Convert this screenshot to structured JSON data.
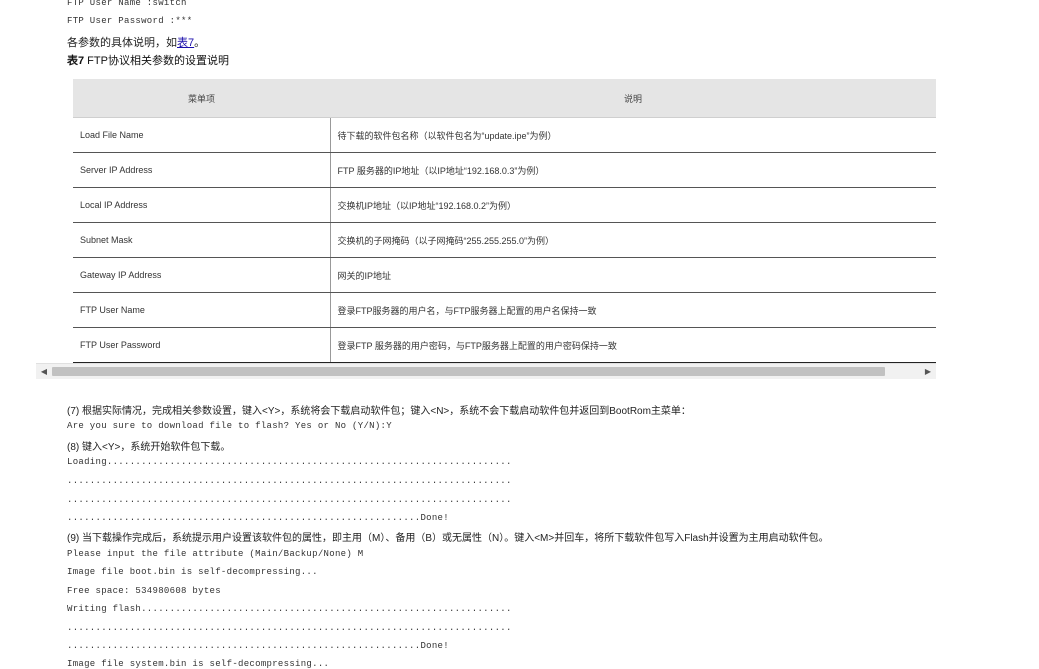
{
  "top_lines": {
    "user_name": "FTP User Name       :switch",
    "user_password": "FTP User Password   :***"
  },
  "intro": {
    "before_link": "各参数的具体说明，如",
    "link": "表7",
    "after_link": "。"
  },
  "caption": {
    "label": "表7",
    "text": " FTP协议相关参数的设置说明"
  },
  "table": {
    "headers": [
      "菜单项",
      "说明"
    ],
    "rows": [
      [
        "Load File Name",
        "待下载的软件包名称（以软件包名为“update.ipe”为例）"
      ],
      [
        "Server IP Address",
        "FTP 服务器的IP地址（以IP地址“192.168.0.3”为例）"
      ],
      [
        "Local IP Address",
        "交换机IP地址（以IP地址“192.168.0.2”为例）"
      ],
      [
        "Subnet Mask",
        "交换机的子网掩码（以子网掩码“255.255.255.0”为例）"
      ],
      [
        "Gateway IP Address",
        "网关的IP地址"
      ],
      [
        "FTP User Name",
        "登录FTP服务器的用户名，与FTP服务器上配置的用户名保持一致"
      ],
      [
        "FTP User Password",
        "登录FTP 服务器的用户密码，与FTP服务器上配置的用户密码保持一致"
      ]
    ]
  },
  "scrollbar": {
    "left_arrow": "◀",
    "right_arrow": "▶"
  },
  "steps": {
    "step7": "(7)   根据实际情况，完成相关参数设置，键入<Y>，系统将会下载启动软件包；键入<N>，系统不会下载启动软件包并返回到BootRom主菜单：",
    "confirm": "Are you sure to download file to flash? Yes or No (Y/N):Y",
    "step8": "(8)   键入<Y>，系统开始软件包下载。",
    "loading1": "Loading.......................................................................",
    "loading2": "..............................................................................",
    "loading3": "..............................................................................",
    "loading_done": "..............................................................Done!",
    "step9": "(9)   当下载操作完成后，系统提示用户设置该软件包的属性，即主用（M）、备用（B）或无属性（N）。键入<M>并回车，将所下载软件包写入Flash并设置为主用启动软件包。",
    "input_attr": "Please input the file attribute (Main/Backup/None) M",
    "self_decomp1": "Image file boot.bin is self-decompressing...",
    "free_space": "Free space: 534980608 bytes",
    "writing1": "Writing flash.................................................................",
    "writing2": "..............................................................................",
    "writing_done": "..............................................................Done!",
    "self_decomp2": "Image file system.bin is self-decompressing..."
  }
}
